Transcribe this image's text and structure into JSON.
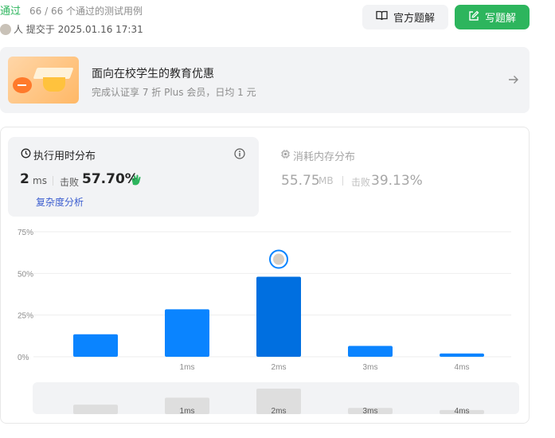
{
  "header": {
    "status": "通过",
    "passed": "66 / 66 个通过的测试用例",
    "submitter": "人 提交于 2025.01.16 17:31",
    "official_label": "官方题解",
    "write_label": "写题解"
  },
  "promo": {
    "title": "面向在校学生的教育优惠",
    "subtitle": "完成认证享 7 折 Plus 会员，日均 1 元"
  },
  "runtime": {
    "title": "执行用时分布",
    "value": "2",
    "unit": "ms",
    "beat_label": "击败",
    "beat": "57.70%",
    "complexity": "复杂度分析"
  },
  "memory": {
    "title": "消耗内存分布",
    "value": "55.75",
    "unit": "MB",
    "beat_label": "击败",
    "beat": "39.13%"
  },
  "colors": {
    "accent": "#2db55d",
    "bar": "#0a84ff",
    "bar_selected": "#006fe0",
    "link": "#3a5ccf"
  },
  "icons": [
    "book-icon",
    "edit-icon",
    "arrow-right-icon",
    "clock-icon",
    "info-icon",
    "chip-icon",
    "clap-icon"
  ],
  "chart_data": {
    "type": "bar",
    "categories": [
      "",
      "1ms",
      "2ms",
      "3ms",
      "4ms"
    ],
    "values": [
      13.5,
      28.5,
      48,
      6.5,
      2
    ],
    "selected_index": 2,
    "yticks": [
      "0%",
      "25%",
      "50%",
      "75%"
    ],
    "ylim": [
      0,
      75
    ],
    "grid": true,
    "navigator_labels": [
      "",
      "1ms",
      "2ms",
      "3ms",
      "4ms"
    ]
  }
}
